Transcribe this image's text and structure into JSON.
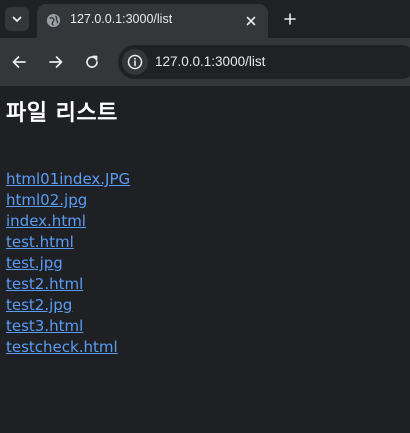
{
  "tab": {
    "title": "127.0.0.1:3000/list"
  },
  "omnibox": {
    "url": "127.0.0.1:3000/list"
  },
  "page": {
    "title": "파일 리스트",
    "files": [
      "html01index.JPG",
      "html02.jpg",
      "index.html",
      "test.html",
      "test.jpg",
      "test2.html",
      "test2.jpg",
      "test3.html",
      "testcheck.html"
    ]
  },
  "colors": {
    "link": "#5a9cf6",
    "background": "#1f2023",
    "toolbar": "#35363a"
  }
}
